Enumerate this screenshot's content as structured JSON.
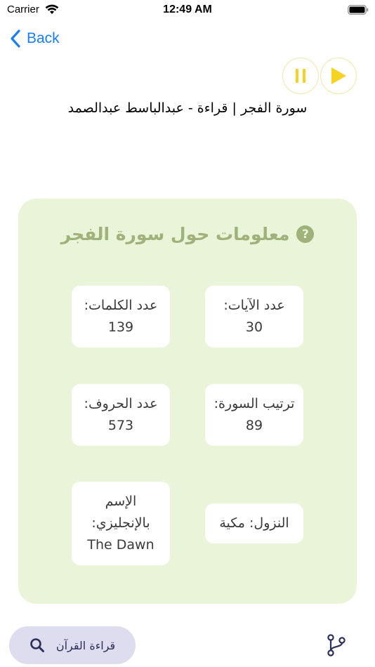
{
  "status_bar": {
    "carrier": "Carrier",
    "time": "12:49 AM"
  },
  "nav": {
    "back_label": "Back"
  },
  "player": {
    "track_title": "سورة الفجر | قراءة - عبدالباسط عبدالصمد"
  },
  "info": {
    "title": "معلومات حول سورة الفجر",
    "help_icon": "?",
    "stats": {
      "verses": {
        "label": "عدد الآيات:",
        "value": "30"
      },
      "words": {
        "label": "عدد الكلمات:",
        "value": "139"
      },
      "order": {
        "label": "ترتيب السورة: 89"
      },
      "letters": {
        "label": "عدد الحروف:",
        "value": "573"
      },
      "revelation": {
        "label": "النزول: مكية"
      },
      "english_name": {
        "label": "الإسم بالإنجليزي:",
        "value": "The Dawn"
      }
    }
  },
  "bottom": {
    "read_label": "قراءة القرآن"
  },
  "colors": {
    "accent": "#1a7ef5",
    "player_yellow": "#f5d320",
    "card_bg": "#eaf4d9",
    "card_title": "#9fb27a",
    "pill_bg": "#dedcef",
    "icon_navy": "#2b2f5c"
  },
  "icons": [
    "wifi-icon",
    "battery-icon",
    "back-chevron-icon",
    "pause-icon",
    "play-icon",
    "help-icon",
    "search-icon",
    "branch-icon"
  ]
}
